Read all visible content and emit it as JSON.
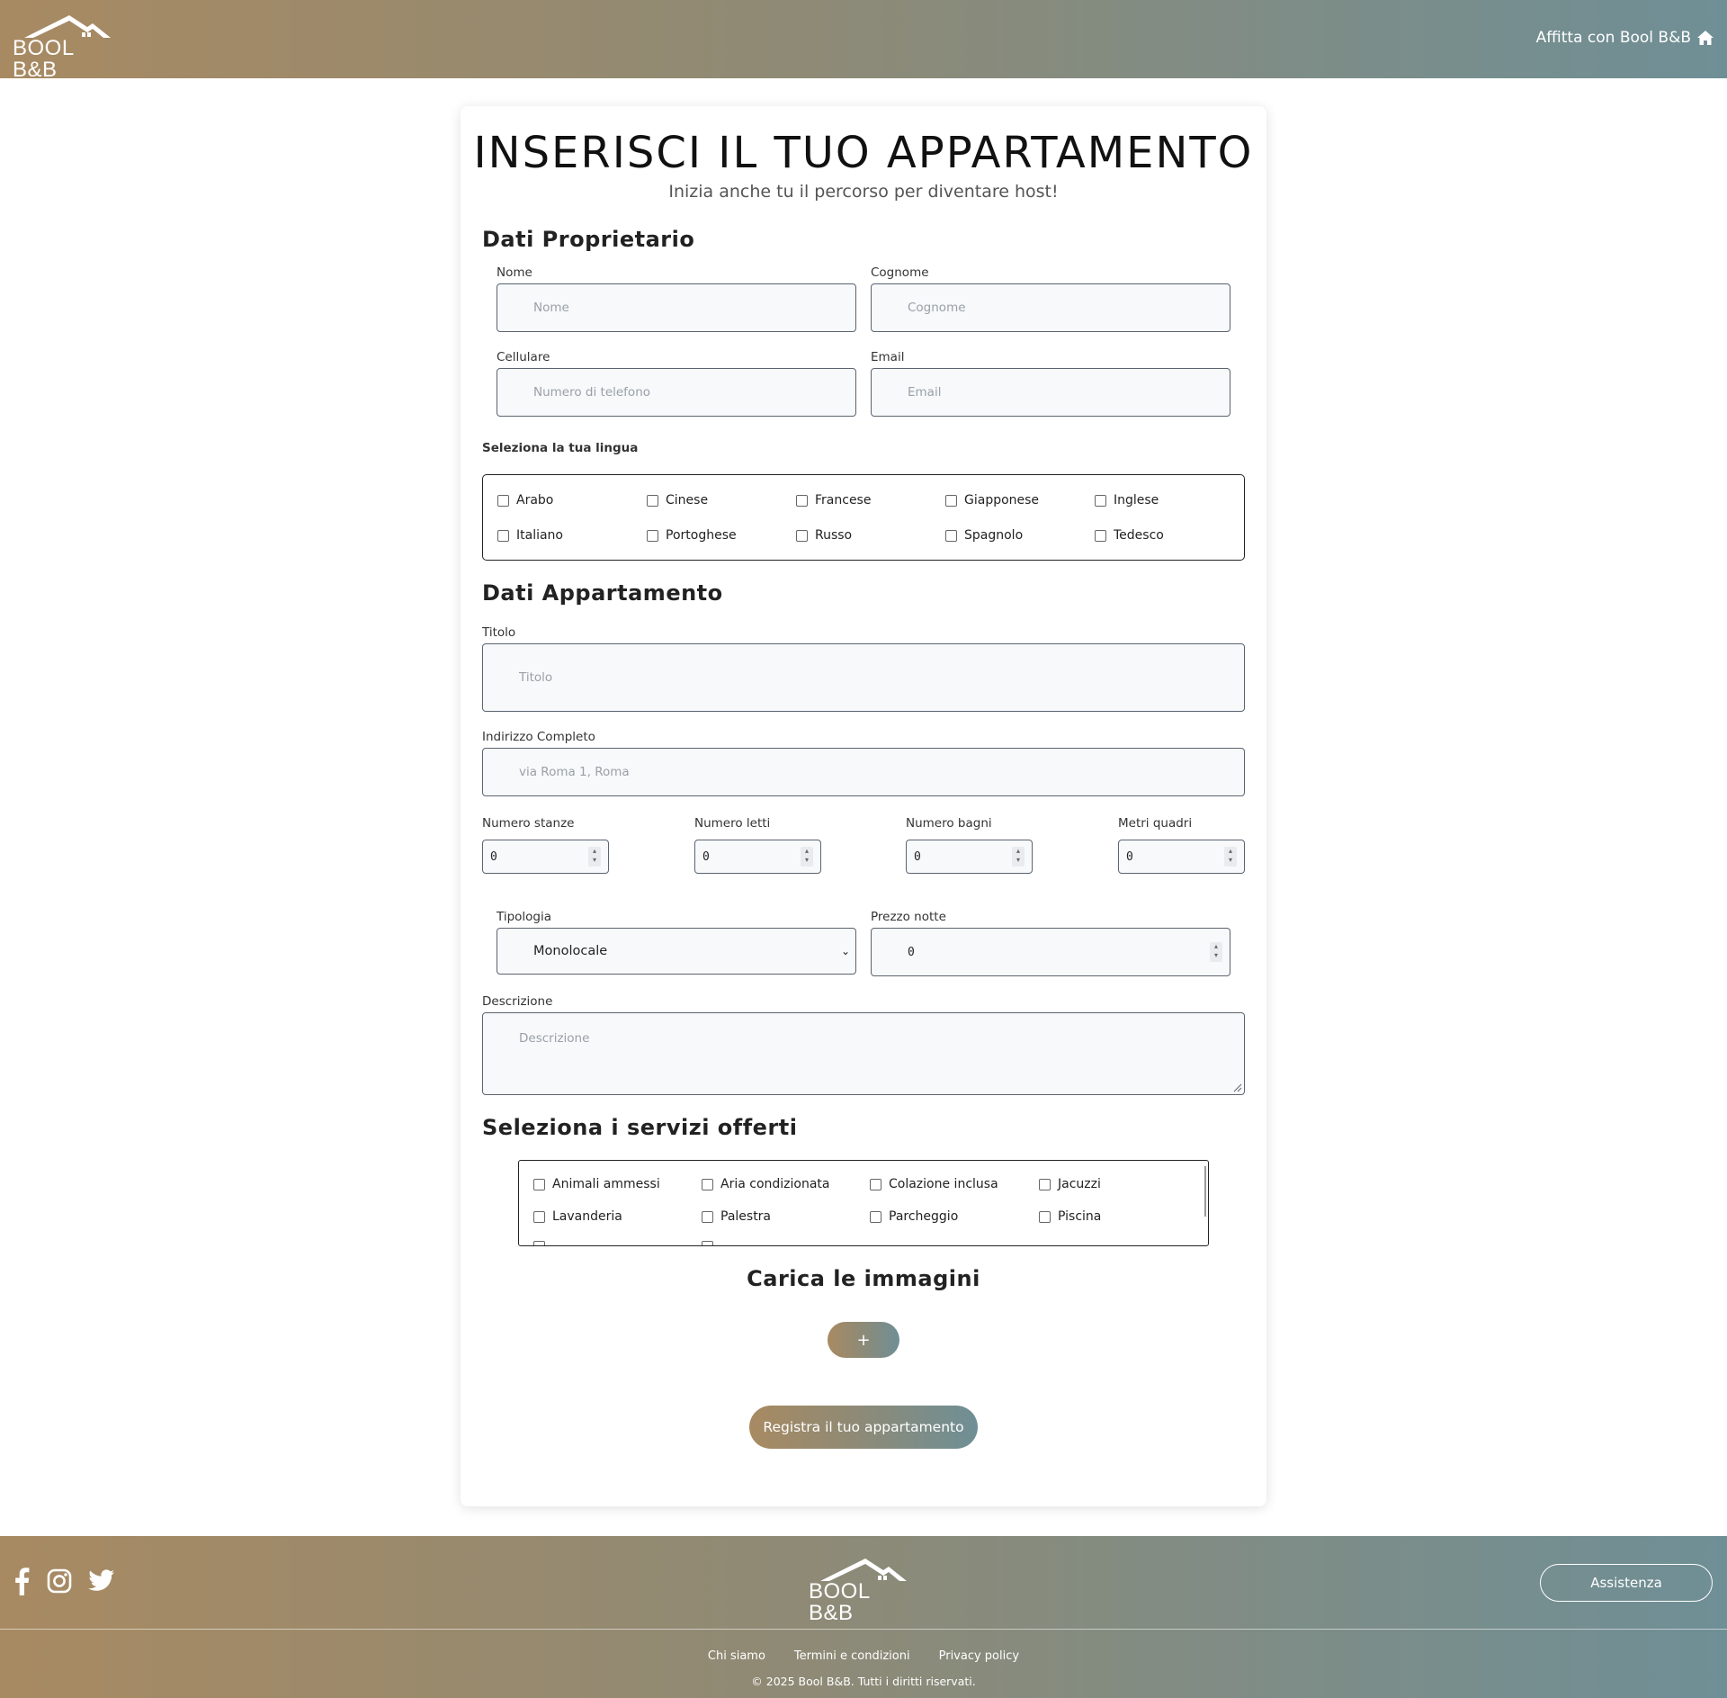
{
  "header": {
    "logo_text": "BOOL B&B",
    "host_link": "Affitta con Bool B&B"
  },
  "form": {
    "title": "INSERISCI IL TUO APPARTAMENTO",
    "subtitle": "Inizia anche tu il percorso per diventare host!",
    "owner_section": "Dati Proprietario",
    "nome_label": "Nome",
    "nome_placeholder": "Nome",
    "cognome_label": "Cognome",
    "cognome_placeholder": "Cognome",
    "cellulare_label": "Cellulare",
    "cellulare_placeholder": "Numero di telefono",
    "email_label": "Email",
    "email_placeholder": "Email",
    "lingua_label": "Seleziona la tua lingua",
    "languages": [
      "Arabo",
      "Cinese",
      "Francese",
      "Giapponese",
      "Inglese",
      "Italiano",
      "Portoghese",
      "Russo",
      "Spagnolo",
      "Tedesco"
    ],
    "apartment_section": "Dati Appartamento",
    "titolo_label": "Titolo",
    "titolo_placeholder": "Titolo",
    "indirizzo_label": "Indirizzo Completo",
    "indirizzo_placeholder": "via Roma 1, Roma",
    "stanze_label": "Numero stanze",
    "stanze_value": "0",
    "letti_label": "Numero letti",
    "letti_value": "0",
    "bagni_label": "Numero bagni",
    "bagni_value": "0",
    "metri_label": "Metri quadri",
    "metri_value": "0",
    "tipologia_label": "Tipologia",
    "tipologia_value": "Monolocale",
    "prezzo_label": "Prezzo notte",
    "prezzo_value": "0",
    "descrizione_label": "Descrizione",
    "descrizione_placeholder": "Descrizione",
    "services_section": "Seleziona i servizi offerti",
    "services": [
      "Animali ammessi",
      "Aria condizionata",
      "Colazione inclusa",
      "Jacuzzi",
      "Lavanderia",
      "Palestra",
      "Parcheggio",
      "Piscina"
    ],
    "images_section": "Carica le immagini",
    "add_image_label": "+",
    "submit_label": "Registra il tuo appartamento"
  },
  "footer": {
    "logo_text": "BOOL B&B",
    "assist_label": "Assistenza",
    "links": [
      "Chi siamo",
      "Termini e condizioni",
      "Privacy policy"
    ],
    "copyright": "© 2025 Bool B&B. Tutti i diritti riservati."
  },
  "colors": {
    "gradient_start": "#a88a62",
    "gradient_end": "#6f8f96"
  },
  "icons": [
    "house-logo-icon",
    "home-icon",
    "facebook-icon",
    "instagram-icon",
    "twitter-icon",
    "chevron-down-icon"
  ]
}
